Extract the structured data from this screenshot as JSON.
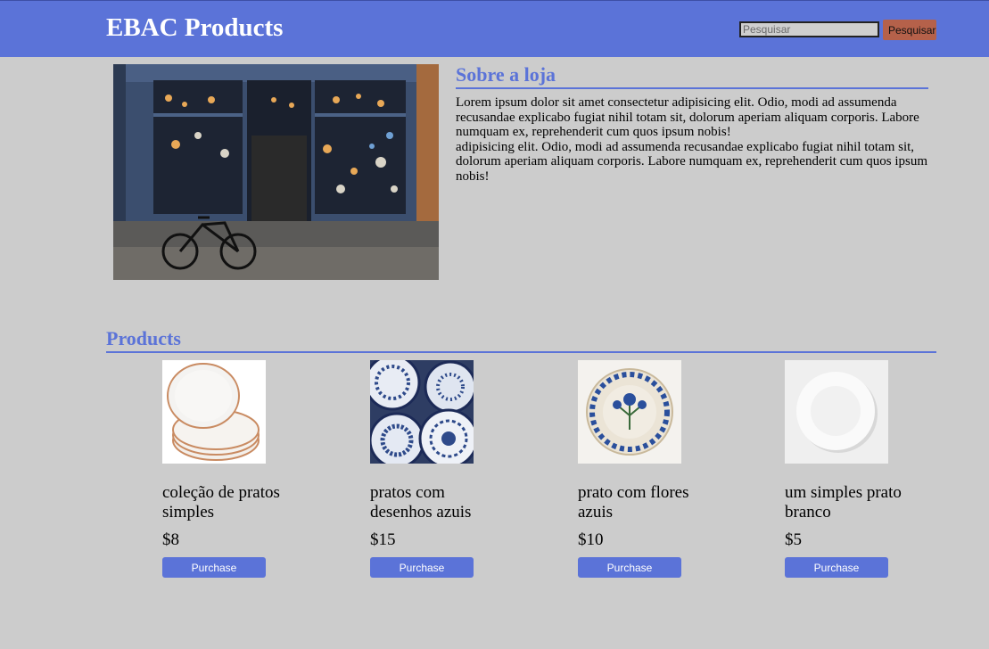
{
  "header": {
    "brand": "EBAC Products",
    "search_placeholder": "Pesquisar",
    "search_button": "Pesquisar"
  },
  "about": {
    "title": "Sobre a loja",
    "paragraph_1": "Lorem ipsum dolor sit amet consectetur adipisicing elit. Odio, modi ad assumenda recusandae explicabo fugiat nihil totam sit, dolorum aperiam aliquam corporis. Labore numquam ex, reprehenderit cum quos ipsum nobis!",
    "paragraph_2": "adipisicing elit. Odio, modi ad assumenda recusandae explicabo fugiat nihil totam sit, dolorum aperiam aliquam corporis. Labore numquam ex, reprehenderit cum quos ipsum nobis!"
  },
  "products": {
    "title": "Products",
    "items": [
      {
        "name": "coleção de pratos simples",
        "price": "$8",
        "button": "Purchase"
      },
      {
        "name": "pratos com desenhos azuis",
        "price": "$15",
        "button": "Purchase"
      },
      {
        "name": "prato com flores azuis",
        "price": "$10",
        "button": "Purchase"
      },
      {
        "name": "um simples prato branco",
        "price": "$5",
        "button": "Purchase"
      }
    ]
  },
  "colors": {
    "header_bg": "#5b73d8",
    "page_bg": "#cccccc",
    "search_button_bg": "#b5614a",
    "accent": "#5b73d8"
  }
}
